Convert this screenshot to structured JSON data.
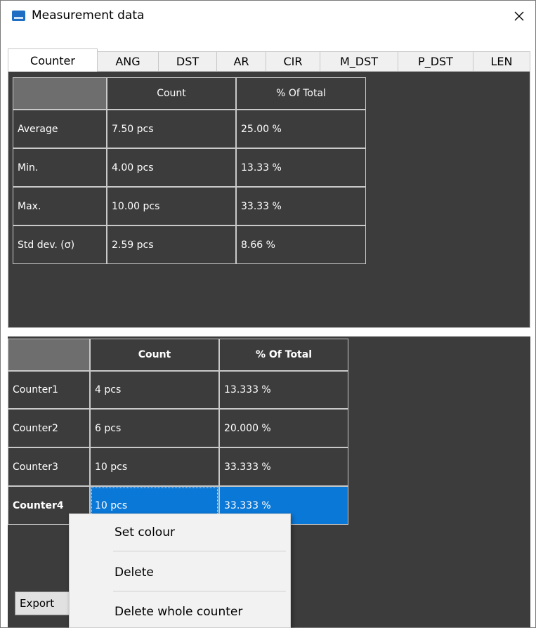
{
  "window": {
    "title": "Measurement data"
  },
  "tabs": [
    "Counter",
    "ANG",
    "DST",
    "AR",
    "CIR",
    "M_DST",
    "P_DST",
    "LEN"
  ],
  "stats": {
    "headers": [
      "Count",
      "% Of Total"
    ],
    "rows": [
      {
        "label": "Average",
        "count": "7.50 pcs",
        "pct": "25.00 %"
      },
      {
        "label": "Min.",
        "count": "4.00 pcs",
        "pct": "13.33 %"
      },
      {
        "label": "Max.",
        "count": "10.00 pcs",
        "pct": "33.33 %"
      },
      {
        "label": "Std dev. (σ)",
        "count": "2.59 pcs",
        "pct": "8.66 %"
      }
    ]
  },
  "counters": {
    "headers": [
      "Count",
      "% Of Total"
    ],
    "rows": [
      {
        "label": "Counter1",
        "count": "4 pcs",
        "pct": "13.333 %"
      },
      {
        "label": "Counter2",
        "count": "6 pcs",
        "pct": "20.000 %"
      },
      {
        "label": "Counter3",
        "count": "10 pcs",
        "pct": "33.333 %"
      },
      {
        "label": "Counter4",
        "count": "10 pcs",
        "pct": "33.333 %"
      }
    ]
  },
  "footer": {
    "export_label": "Export"
  },
  "context_menu": {
    "items": [
      "Set colour",
      "Delete",
      "Delete whole counter"
    ]
  },
  "colors": {
    "panel": "#3c3c3c",
    "selection": "#0a78d7",
    "app_icon": "#1e6fc4"
  }
}
